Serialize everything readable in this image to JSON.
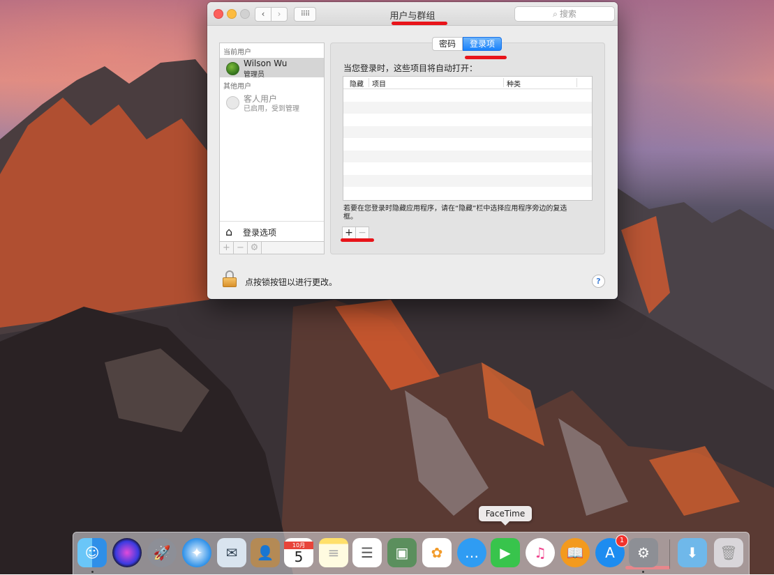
{
  "window": {
    "title": "用户与群组",
    "search_placeholder": "搜索",
    "nav_back": "‹",
    "nav_forward": "›",
    "grid_glyph": "⠿⠿"
  },
  "sidebar": {
    "current_user_header": "当前用户",
    "current_user": {
      "name": "Wilson Wu",
      "role": "管理员"
    },
    "other_users_header": "其他用户",
    "guest_user": {
      "name": "客人用户",
      "status": "已启用，受到管理"
    },
    "login_options_label": "登录选项",
    "tools": {
      "add": "+",
      "remove": "−",
      "gear": "⚙"
    }
  },
  "tabs": [
    {
      "label": "密码",
      "selected": false
    },
    {
      "label": "登录项",
      "selected": true
    }
  ],
  "main": {
    "prompt": "当您登录时，这些项目将自动打开：",
    "columns": [
      "隐藏",
      "项目",
      "种类"
    ],
    "hint": "若要在您登录时隐藏应用程序，请在“隐藏”栏中选择应用程序旁边的复选框。",
    "add_label": "+",
    "remove_label": "−"
  },
  "footer": {
    "lock_label": "点按锁按钮以进行更改。",
    "help_label": "?"
  },
  "dock": {
    "tooltip": "FaceTime",
    "calendar_month": "10月",
    "calendar_day": "5",
    "appstore_badge": "1",
    "items": [
      "finder-icon",
      "siri-icon",
      "launchpad-icon",
      "safari-icon",
      "mail-icon",
      "contacts-icon",
      "calendar-icon",
      "notes-icon",
      "reminders-icon",
      "photobooth-icon",
      "photos-icon",
      "messages-icon",
      "facetime-icon",
      "itunes-icon",
      "ibooks-icon",
      "appstore-icon",
      "system-preferences-icon",
      "downloads-folder-icon",
      "trash-icon"
    ]
  },
  "colors": {
    "accent": "#1a82fb",
    "annotation": "#e8141a"
  }
}
